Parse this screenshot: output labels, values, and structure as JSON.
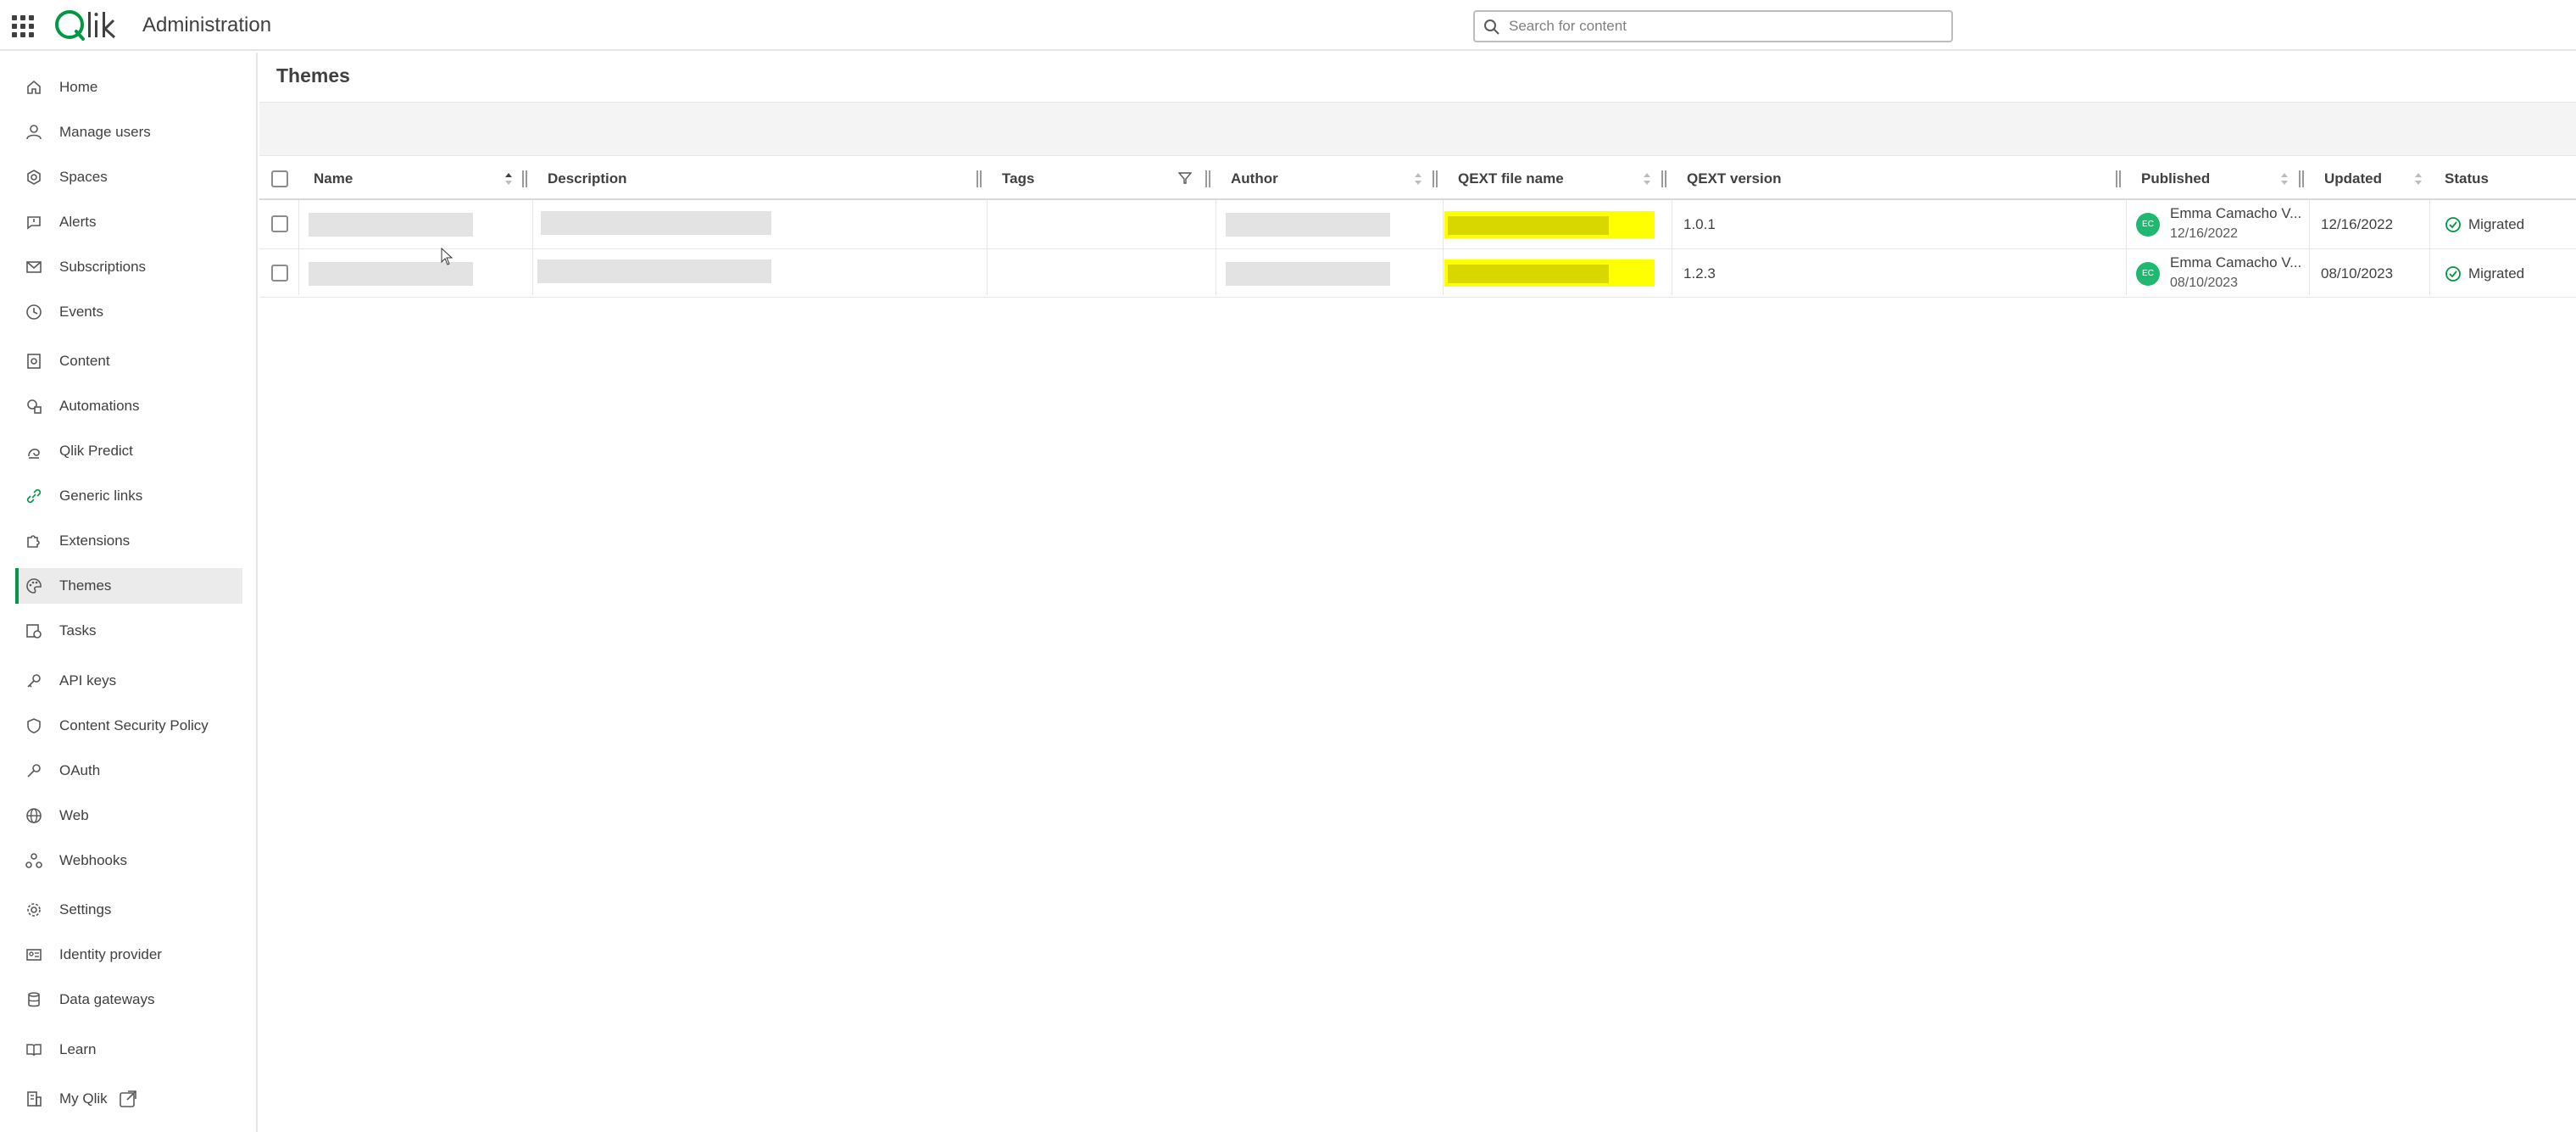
{
  "header": {
    "logo_text": "Qlik",
    "app_title": "Administration",
    "search_placeholder": "Search for content"
  },
  "sidebar": {
    "items": [
      {
        "label": "Home",
        "icon": "home-icon"
      },
      {
        "label": "Manage users",
        "icon": "user-icon"
      },
      {
        "label": "Spaces",
        "icon": "spaces-icon"
      },
      {
        "label": "Alerts",
        "icon": "alert-icon"
      },
      {
        "label": "Subscriptions",
        "icon": "mail-icon"
      },
      {
        "label": "Events",
        "icon": "clock-icon"
      },
      {
        "label": "Content",
        "icon": "content-icon"
      },
      {
        "label": "Automations",
        "icon": "automation-icon"
      },
      {
        "label": "Qlik Predict",
        "icon": "predict-icon"
      },
      {
        "label": "Generic links",
        "icon": "link-icon"
      },
      {
        "label": "Extensions",
        "icon": "puzzle-icon"
      },
      {
        "label": "Themes",
        "icon": "palette-icon",
        "active": true
      },
      {
        "label": "Tasks",
        "icon": "tasks-icon"
      },
      {
        "label": "API keys",
        "icon": "key-icon"
      },
      {
        "label": "Content Security Policy",
        "icon": "shield-icon"
      },
      {
        "label": "OAuth",
        "icon": "oauth-key-icon"
      },
      {
        "label": "Web",
        "icon": "globe-icon"
      },
      {
        "label": "Webhooks",
        "icon": "webhook-icon"
      },
      {
        "label": "Settings",
        "icon": "gear-icon"
      },
      {
        "label": "Identity provider",
        "icon": "id-card-icon"
      },
      {
        "label": "Data gateways",
        "icon": "database-icon"
      },
      {
        "label": "Learn",
        "icon": "book-icon"
      },
      {
        "label": "My Qlik",
        "icon": "building-icon",
        "external": true
      }
    ]
  },
  "main": {
    "page_title": "Themes",
    "columns": [
      "Name",
      "Description",
      "Tags",
      "Author",
      "QEXT file name",
      "QEXT version",
      "Published",
      "Updated",
      "Status"
    ],
    "rows": [
      {
        "qext_version": "1.0.1",
        "avatar_initials": "EC",
        "published_by": "Emma Camacho V...",
        "published_date": "12/16/2022",
        "updated": "12/16/2022",
        "status": "Migrated"
      },
      {
        "qext_version": "1.2.3",
        "avatar_initials": "EC",
        "published_by": "Emma Camacho V...",
        "published_date": "08/10/2023",
        "updated": "08/10/2023",
        "status": "Migrated"
      }
    ]
  },
  "colors": {
    "brand_green": "#009845",
    "highlight_yellow": "#ffff00",
    "avatar_green": "#1fb871",
    "status_green": "#009845"
  }
}
